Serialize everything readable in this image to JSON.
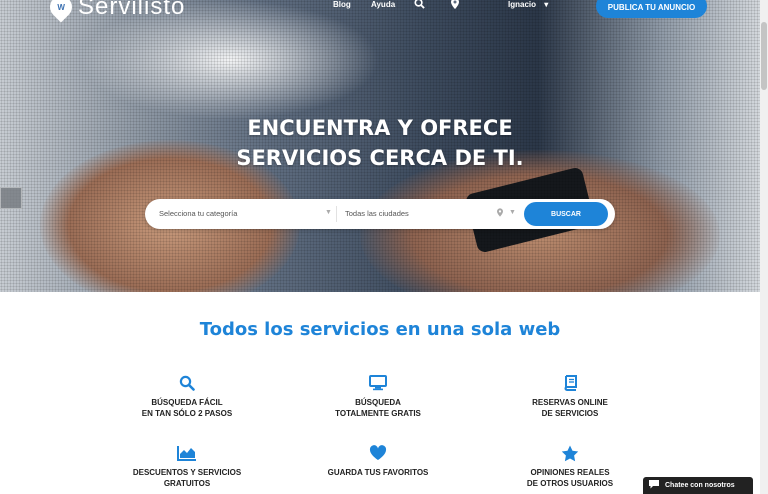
{
  "header": {
    "logo_text": "Servilisto",
    "nav": {
      "blog": "Blog",
      "help": "Ayuda",
      "user": "Ignacio"
    },
    "publish_button": "PUBLICA TU ANUNCIO"
  },
  "hero": {
    "headline_line1": "ENCUENTRA Y OFRECE",
    "headline_line2": "SERVICIOS CERCA DE TI."
  },
  "search": {
    "category_placeholder": "Selecciona tu categoría",
    "city_placeholder": "Todas las ciudades",
    "button": "BUSCAR"
  },
  "features": {
    "title": "Todos los servicios en una sola web",
    "items": [
      {
        "icon": "search-icon",
        "line1": "BÚSQUEDA FÁCIL",
        "line2": "EN TAN SÓLO 2 PASOS"
      },
      {
        "icon": "monitor-icon",
        "line1": "BÚSQUEDA",
        "line2": "TOTALMENTE GRATIS"
      },
      {
        "icon": "book-icon",
        "line1": "RESERVAS ONLINE",
        "line2": "DE SERVICIOS"
      },
      {
        "icon": "area-chart-icon",
        "line1": "DESCUENTOS Y SERVICIOS",
        "line2": "GRATUITOS"
      },
      {
        "icon": "heart-icon",
        "line1": "GUARDA TUS FAVORITOS",
        "line2": ""
      },
      {
        "icon": "star-icon",
        "line1": "OPINIONES REALES",
        "line2": "DE OTROS USUARIOS"
      }
    ]
  },
  "chat": {
    "label": "Chatee con nosotros"
  },
  "colors": {
    "accent": "#1e84d8",
    "text": "#222222",
    "chat_bg": "#222222"
  }
}
